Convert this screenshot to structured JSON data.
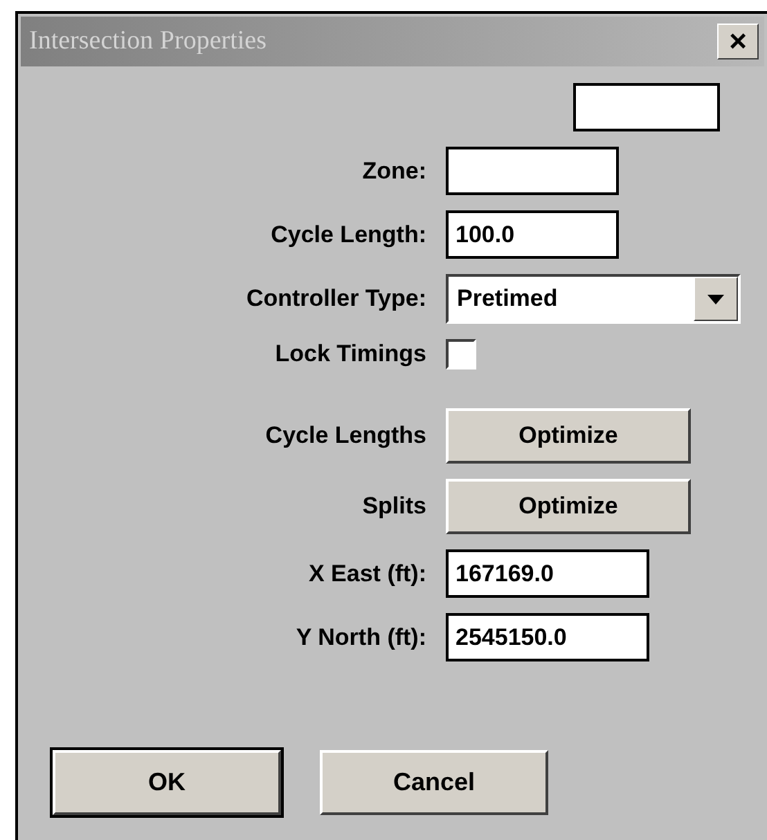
{
  "window": {
    "title": "Intersection Properties",
    "close": "×"
  },
  "fields": [
    {
      "kind": "wide-text"
    },
    {
      "kind": "text",
      "label": "Zone:"
    },
    {
      "kind": "text",
      "label": "Cycle Length:",
      "value": "100.0"
    },
    {
      "kind": "combo",
      "label": "Controller Type:",
      "value": "Pretimed"
    },
    {
      "kind": "checkbox",
      "label": "Lock Timings",
      "checked": false
    },
    {
      "kind": "gap"
    },
    {
      "kind": "button",
      "label": "Cycle Lengths",
      "button": "Optimize"
    },
    {
      "kind": "button",
      "label": "Splits",
      "button": "Optimize"
    },
    {
      "kind": "text",
      "label": "X East (ft):",
      "value": "167169.0"
    },
    {
      "kind": "text",
      "label": "Y North (ft):",
      "value": "2545150.0"
    }
  ],
  "buttons": [
    {
      "label": "OK",
      "default": true
    },
    {
      "label": "Cancel",
      "default": false
    }
  ]
}
